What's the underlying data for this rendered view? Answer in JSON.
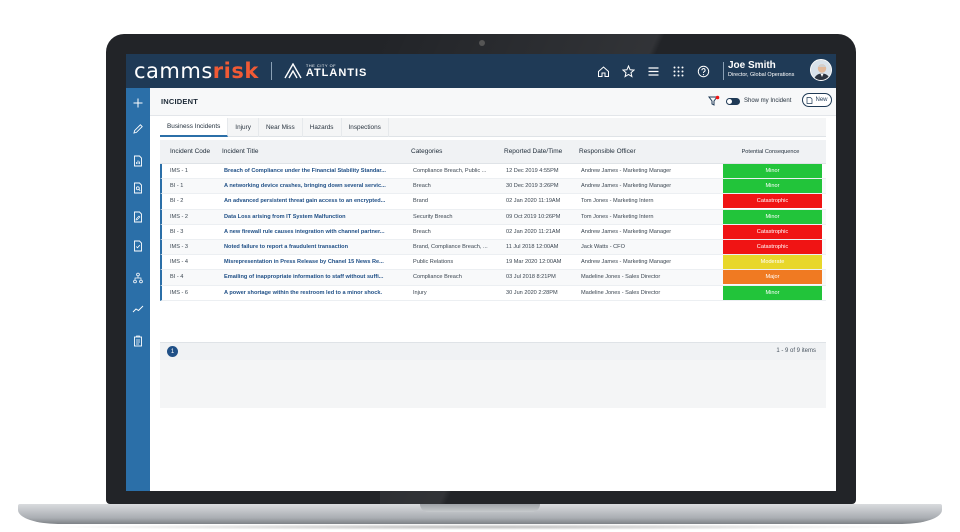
{
  "header": {
    "brand_main": "camms",
    "brand_accent": "risk",
    "org_small": "THE CITY OF",
    "org_big": "ATLANTIS",
    "user_name": "Joe Smith",
    "user_role": "Director, Global Operations",
    "icons": [
      "home-icon",
      "star-icon",
      "menu-icon",
      "apps-grid-icon",
      "help-icon"
    ]
  },
  "sidebar": {
    "icons": [
      "plus-icon",
      "pencil-icon",
      "doc-chart-icon",
      "doc-search-icon",
      "doc-edit-icon",
      "doc-check-icon",
      "hierarchy-icon",
      "trend-icon",
      "clipboard-icon"
    ]
  },
  "page": {
    "title": "INCIDENT",
    "show_my_incident": "Show my Incident",
    "new_label": "New"
  },
  "tabs": [
    {
      "label": "Business Incidents",
      "active": true
    },
    {
      "label": "Injury",
      "active": false
    },
    {
      "label": "Near Miss",
      "active": false
    },
    {
      "label": "Hazards",
      "active": false
    },
    {
      "label": "Inspections",
      "active": false
    }
  ],
  "grid": {
    "columns": [
      "Incident Code",
      "Incident Title",
      "Categories",
      "Reported Date/Time",
      "Responsible Officer",
      "Potential Consequence"
    ],
    "rows": [
      {
        "code": "IMS - 1",
        "title": "Breach of Compliance under the Financial Stability Standar...",
        "category": "Compliance Breach, Public ...",
        "date": "12 Dec 2019 4:55PM",
        "officer": "Andrew James - Marketing Manager",
        "consequence": "Minor"
      },
      {
        "code": "BI - 1",
        "title": "A networking device crashes, bringing down several servic...",
        "category": "Breach",
        "date": "30 Dec 2019 3:26PM",
        "officer": "Andrew James - Marketing Manager",
        "consequence": "Minor"
      },
      {
        "code": "BI - 2",
        "title": "An advanced persistent threat gain access to an encrypted...",
        "category": "Brand",
        "date": "02 Jan 2020 11:19AM",
        "officer": "Tom Jones - Marketing Intern",
        "consequence": "Catastrophic"
      },
      {
        "code": "IMS - 2",
        "title": "Data Loss arising from IT System Malfunction",
        "category": "Security Breach",
        "date": "09 Oct 2019 10:26PM",
        "officer": "Tom Jones - Marketing Intern",
        "consequence": "Minor"
      },
      {
        "code": "BI - 3",
        "title": "A new firewall rule causes integration with channel partner...",
        "category": "Breach",
        "date": "02 Jan 2020 11:21AM",
        "officer": "Andrew James - Marketing Manager",
        "consequence": "Catastrophic"
      },
      {
        "code": "IMS - 3",
        "title": "Noted failure to report a fraudulent transaction",
        "category": "Brand, Compliance Breach, ...",
        "date": "11 Jul 2018 12:00AM",
        "officer": "Jack Watts - CFO",
        "consequence": "Catastrophic"
      },
      {
        "code": "IMS - 4",
        "title": "Misrepresentation in Press Release by Chanel 15 News Re...",
        "category": "Public Relations",
        "date": "19 Mar 2020 12:00AM",
        "officer": "Andrew James - Marketing Manager",
        "consequence": "Moderate"
      },
      {
        "code": "BI - 4",
        "title": "Emailing of inappropriate information to staff without suffi...",
        "category": "Compliance Breach",
        "date": "03 Jul 2018 8:21PM",
        "officer": "Madeline Jones - Sales Director",
        "consequence": "Major"
      },
      {
        "code": "IMS - 6",
        "title": "A power shortage within the restroom led to a minor shock.",
        "category": "Injury",
        "date": "30 Jun 2020 2:28PM",
        "officer": "Madeline Jones - Sales Director",
        "consequence": "Minor"
      }
    ]
  },
  "pager": {
    "current_page": "1",
    "count": "1 - 9 of 9 items"
  },
  "colors": {
    "Minor": "#22c43a",
    "Catastrophic": "#f01414",
    "Moderate": "#e8d72a",
    "Major": "#f07a22",
    "header_bg": "#1f3a56",
    "sidebar_bg": "#2b6fa8",
    "brand_accent": "#f15a35"
  }
}
